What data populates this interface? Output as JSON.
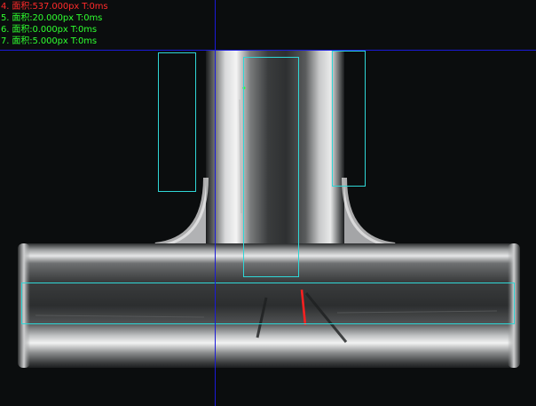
{
  "viewer": {
    "overlay_results": [
      {
        "text": "4. 面积:537.000px  T:0ms",
        "color": "#ff2a2a"
      },
      {
        "text": "5. 面积:20.000px  T:0ms",
        "color": "#2fff2f"
      },
      {
        "text": "6. 面积:0.000px  T:0ms",
        "color": "#2fff2f"
      },
      {
        "text": "7. 面积:5.000px  T:0ms",
        "color": "#2fff2f"
      }
    ]
  },
  "colors": {
    "ok_text": "#2fff2f",
    "ng_text": "#ff2a2a",
    "roi_outline": "#2fd6d6",
    "crosshair": "#1a1ad8",
    "defect_mark": "#ff2020"
  }
}
